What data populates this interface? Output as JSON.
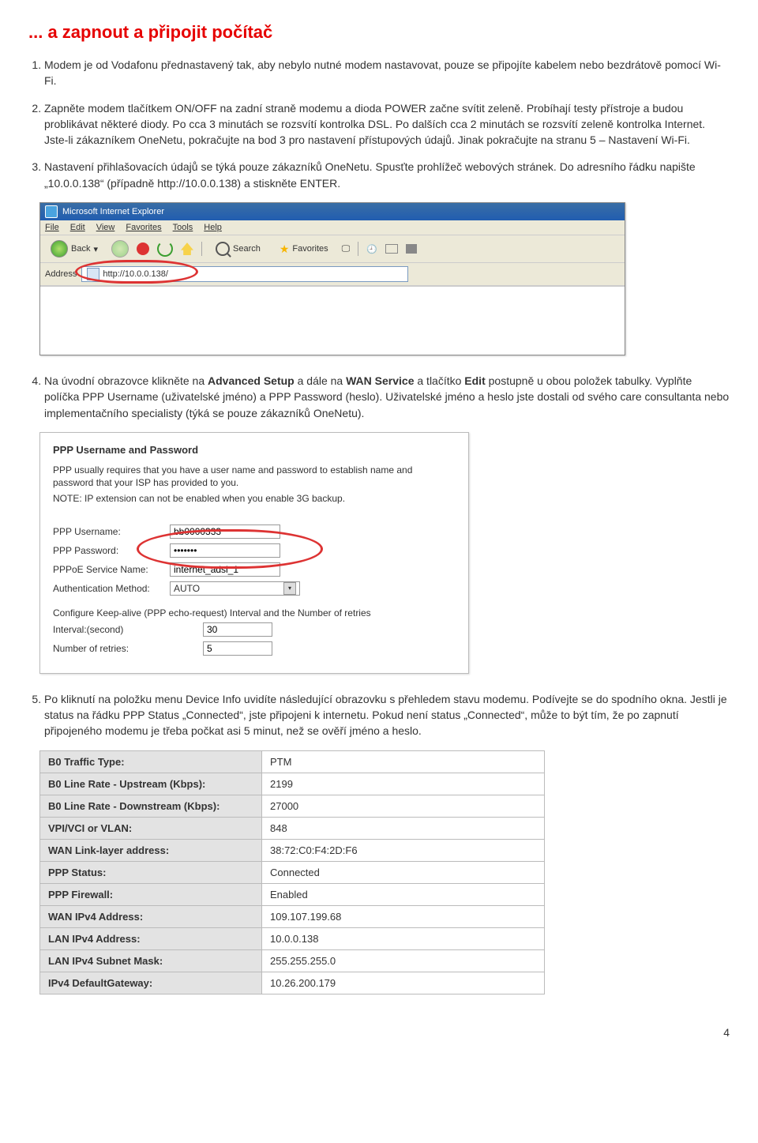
{
  "page_number": "4",
  "heading": "... a zapnout a připojit počítač",
  "items": {
    "i1": "Modem je od Vodafonu přednastavený tak, aby nebylo nutné modem nastavovat, pouze se připojíte kabelem nebo bezdrátově pomocí Wi-Fi.",
    "i2": "Zapněte modem tlačítkem ON/OFF na zadní straně modemu a dioda POWER začne svítit zeleně. Probíhají testy přístroje a budou problikávat některé diody. Po cca 3 minutách se rozsvítí kontrolka DSL. Po dalších cca 2 minutách se rozsvítí zeleně kontrolka Internet. Jste-li zákazníkem OneNetu, pokračujte na bod 3 pro nastavení přístupových údajů. Jinak pokračujte na stranu 5 – Nastavení Wi-Fi.",
    "i3": "Nastavení přihlašovacích údajů se týká pouze zákazníků OneNetu. Spusťte prohlížeč webových stránek. Do adresního řádku napište „10.0.0.138“ (případně http://10.0.0.138) a stiskněte ENTER.",
    "i4a": "Na úvodní obrazovce klikněte na ",
    "i4b": " a dále na ",
    "i4c": " a tlačítko ",
    "i4d": " postupně u obou položek tabulky. Vyplňte políčka PPP Username (uživatelské jméno) a PPP Password (heslo). Uživatelské jméno a heslo jste dostali od svého care consultanta nebo implementačního specialisty (týká se pouze zákazníků OneNetu).",
    "i4_adv": "Advanced Setup",
    "i4_wan": "WAN Service",
    "i4_edit": "Edit",
    "i5": "Po kliknutí na položku menu Device Info uvidíte následující obrazovku s přehledem stavu modemu. Podívejte se do spodního okna. Jestli je status na řádku PPP Status „Connected“, jste připojeni k internetu. Pokud není status „Connected“, může to být tím, že po zapnutí připojeného modemu je třeba počkat asi 5 minut, než se ověří jméno a heslo."
  },
  "ie": {
    "title": "Microsoft Internet Explorer",
    "menu": {
      "file": "File",
      "edit": "Edit",
      "view": "View",
      "fav": "Favorites",
      "tools": "Tools",
      "help": "Help"
    },
    "toolbar": {
      "back": "Back",
      "search": "Search",
      "favorites": "Favorites"
    },
    "addr_label": "Address",
    "url": "http://10.0.0.138/"
  },
  "ppp": {
    "title": "PPP Username and Password",
    "desc1": "PPP usually requires that you have a user name and password to establish name and password that your ISP has provided to you.",
    "desc2": "NOTE: IP extension can not be enabled when you enable 3G backup.",
    "user_lbl": "PPP Username:",
    "user_val": "bb0000333",
    "pass_lbl": "PPP Password:",
    "pass_val": "•••••••",
    "svc_lbl": "PPPoE Service Name:",
    "svc_val": "internet_adsl_1",
    "auth_lbl": "Authentication Method:",
    "auth_val": "AUTO",
    "keep": "Configure Keep-alive (PPP echo-request) Interval and the Number of retries",
    "int_lbl": "Interval:(second)",
    "int_val": "30",
    "ret_lbl": "Number of retries:",
    "ret_val": "5"
  },
  "status": [
    {
      "k": "B0 Traffic Type:",
      "v": "PTM"
    },
    {
      "k": "B0 Line Rate - Upstream (Kbps):",
      "v": "2199"
    },
    {
      "k": "B0 Line Rate - Downstream (Kbps):",
      "v": "27000"
    },
    {
      "k": "VPI/VCI or VLAN:",
      "v": "848"
    },
    {
      "k": "WAN Link-layer address:",
      "v": "38:72:C0:F4:2D:F6"
    },
    {
      "k": "PPP Status:",
      "v": "Connected"
    },
    {
      "k": "PPP Firewall:",
      "v": "Enabled"
    },
    {
      "k": "WAN IPv4 Address:",
      "v": "109.107.199.68"
    },
    {
      "k": "LAN IPv4 Address:",
      "v": "10.0.0.138"
    },
    {
      "k": "LAN IPv4 Subnet Mask:",
      "v": "255.255.255.0"
    },
    {
      "k": "IPv4 DefaultGateway:",
      "v": "10.26.200.179"
    }
  ]
}
